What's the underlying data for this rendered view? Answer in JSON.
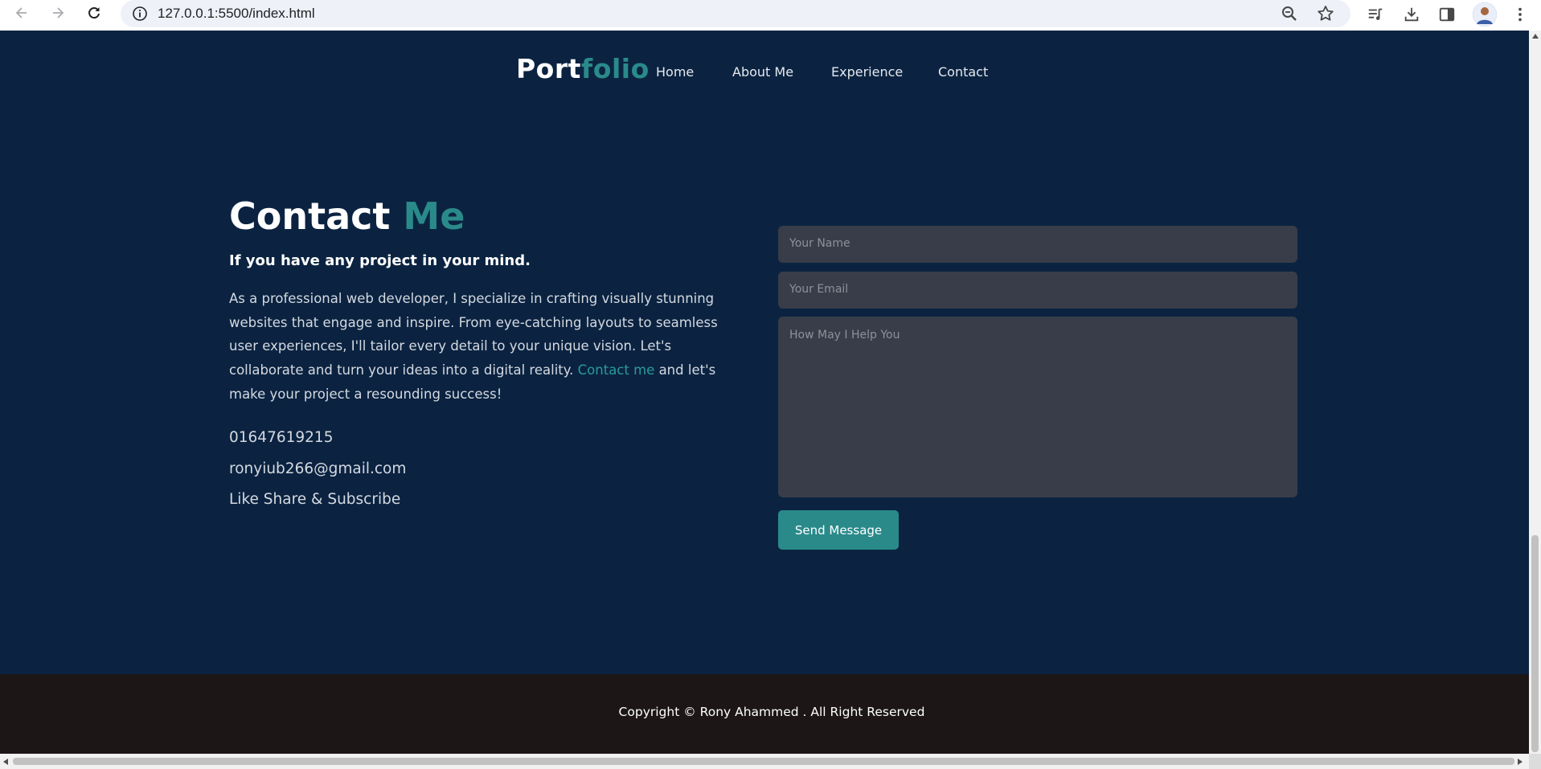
{
  "browser": {
    "url": "127.0.0.1:5500/index.html",
    "icons": [
      "back-icon",
      "forward-icon",
      "reload-icon",
      "info-icon",
      "zoom-icon",
      "star-icon",
      "playlist-icon",
      "download-icon",
      "side-panel-icon",
      "profile-avatar",
      "kebab-menu-icon"
    ]
  },
  "header": {
    "logo_main": "Port",
    "logo_accent": "folio",
    "nav": [
      "Home",
      "About Me",
      "Experience",
      "Contact"
    ]
  },
  "contact": {
    "title_main": "Contact ",
    "title_accent": "Me",
    "subtitle": "If you have any project in your mind.",
    "paragraph_before_link": "As a professional web developer, I specialize in crafting visually stunning websites that engage and inspire. From eye-catching layouts to seamless user experiences, I'll tailor every detail to your unique vision. Let's collaborate and turn your ideas into a digital reality. ",
    "paragraph_link": "Contact me",
    "paragraph_after_link": " and let's make your project a resounding success!",
    "phone": "01647619215",
    "email": "ronyiub266@gmail.com",
    "social": "Like Share & Subscribe"
  },
  "form": {
    "name_placeholder": "Your Name",
    "email_placeholder": "Your Email",
    "message_placeholder": "How May I Help You",
    "send_label": "Send Message"
  },
  "footer": {
    "copyright": "Copyright © Rony Ahammed . All Right Reserved"
  },
  "colors": {
    "page_bg": "#0b2341",
    "accent": "#2a8a8a",
    "input_bg": "#383d49",
    "footer_bg": "#1c1616"
  }
}
